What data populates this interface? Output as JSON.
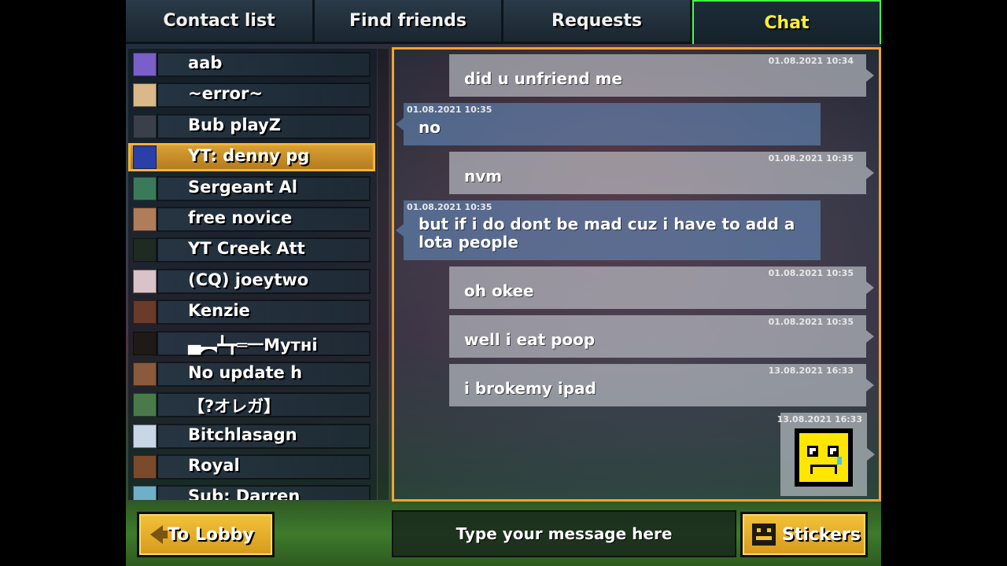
{
  "tabs": [
    {
      "label": "Contact list",
      "active": false
    },
    {
      "label": "Find friends",
      "active": false
    },
    {
      "label": "Requests",
      "active": false
    },
    {
      "label": "Chat",
      "active": true
    }
  ],
  "contacts": [
    {
      "name": "aab",
      "avatar_color": "#7a5fc9"
    },
    {
      "name": "~error~",
      "avatar_color": "#d9b98a"
    },
    {
      "name": "Bub playZ",
      "avatar_color": "#3a3f4a"
    },
    {
      "name": "YT: denny pg",
      "avatar_color": "#2a3fa8",
      "selected": true
    },
    {
      "name": "Sergeant Al",
      "avatar_color": "#3a7a5a"
    },
    {
      "name": "free novice",
      "avatar_color": "#b07d5a"
    },
    {
      "name": "YT Creek Att",
      "avatar_color": "#1f2a22"
    },
    {
      "name": "(CQ) joeytwo",
      "avatar_color": "#d9c2c8"
    },
    {
      "name": "Kenzie",
      "avatar_color": "#6a3b2a"
    },
    {
      "name": "▄︻┻┳═一Mутнi",
      "avatar_color": "#1e1a16"
    },
    {
      "name": "No update h",
      "avatar_color": "#8a5a3a"
    },
    {
      "name": "【?オレガ】",
      "avatar_color": "#4a7a4a"
    },
    {
      "name": "Bitchlasagn",
      "avatar_color": "#c9d6e6"
    },
    {
      "name": "Royal",
      "avatar_color": "#7a4a2a"
    },
    {
      "name": "Sub: Darren",
      "avatar_color": "#6fb0c9"
    }
  ],
  "messages": [
    {
      "dir": "out",
      "time": "01.08.2021 10:34",
      "text": "did u unfriend me"
    },
    {
      "dir": "in",
      "time": "01.08.2021 10:35",
      "text": "no"
    },
    {
      "dir": "out",
      "time": "01.08.2021 10:35",
      "text": "nvm"
    },
    {
      "dir": "in",
      "time": "01.08.2021 10:35",
      "text": "but if i do dont be mad cuz i have to add a lota people"
    },
    {
      "dir": "out",
      "time": "01.08.2021 10:35",
      "text": "oh okee"
    },
    {
      "dir": "out",
      "time": "01.08.2021 10:35",
      "text": "well i eat poop"
    },
    {
      "dir": "out",
      "time": "13.08.2021 16:33",
      "text": "i brokemy ipad"
    },
    {
      "dir": "out",
      "time": "13.08.2021 16:33",
      "sticker": "crying-face-sticker"
    }
  ],
  "bottom": {
    "lobby_label": "To Lobby",
    "input_placeholder": "Type your message here",
    "stickers_label": "Stickers"
  },
  "colors": {
    "active_tab_text": "#ffee33",
    "active_tab_border": "#44ff44",
    "chat_border": "#f0a530",
    "gold_button": "#f2c23a",
    "selected_contact": "#d8a034"
  }
}
